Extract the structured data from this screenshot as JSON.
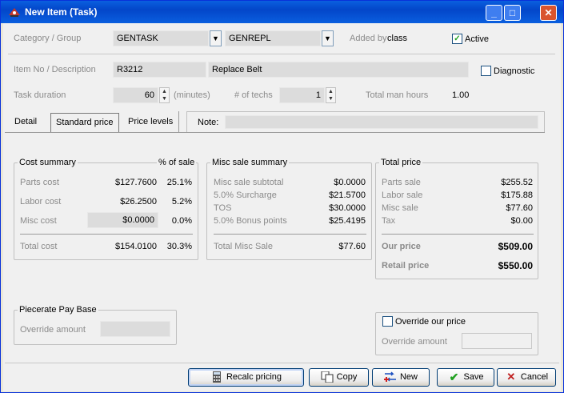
{
  "window": {
    "title": "New Item (Task)"
  },
  "header": {
    "category_group_label": "Category / Group",
    "category_value": "GENTASK",
    "group_value": "GENREPL",
    "added_by_label": "Added by",
    "added_by_value": "class",
    "active_label": "Active",
    "active_checked": true
  },
  "item": {
    "item_no_label": "Item No / Description",
    "item_no_value": "R3212",
    "description_value": "Replace Belt",
    "diagnostic_label": "Diagnostic",
    "diagnostic_checked": false,
    "task_duration_label": "Task duration",
    "task_duration_value": "60",
    "minutes_label": "(minutes)",
    "techs_label": "# of techs",
    "techs_value": "1",
    "total_man_hours_label": "Total man hours",
    "total_man_hours_value": "1.00"
  },
  "tabs": [
    {
      "label": "Detail"
    },
    {
      "label": "Standard price"
    },
    {
      "label": "Price levels"
    }
  ],
  "note_label": "Note:",
  "cost_summary": {
    "title": "Cost summary",
    "pct_header": "% of sale",
    "rows": [
      {
        "label": "Parts cost",
        "value": "$127.7600",
        "pct": "25.1%"
      },
      {
        "label": "Labor cost",
        "value": "$26.2500",
        "pct": "5.2%"
      },
      {
        "label": "Misc cost",
        "value": "$0.0000",
        "pct": "0.0%"
      }
    ],
    "total_label": "Total cost",
    "total_value": "$154.0100",
    "total_pct": "30.3%"
  },
  "misc_summary": {
    "title": "Misc sale summary",
    "rows": [
      {
        "label": "Misc sale subtotal",
        "value": "$0.0000"
      },
      {
        "label": "5.0% Surcharge",
        "value": "$21.5700"
      },
      {
        "label": "TOS",
        "value": "$30.0000"
      },
      {
        "label": "5.0% Bonus points",
        "value": "$25.4195"
      }
    ],
    "total_label": "Total Misc Sale",
    "total_value": "$77.60"
  },
  "total_price": {
    "title": "Total price",
    "rows": [
      {
        "label": "Parts sale",
        "value": "$255.52"
      },
      {
        "label": "Labor sale",
        "value": "$175.88"
      },
      {
        "label": "Misc sale",
        "value": "$77.60"
      },
      {
        "label": "Tax",
        "value": "$0.00"
      }
    ],
    "our_price_label": "Our price",
    "our_price_value": "$509.00",
    "retail_price_label": "Retail price",
    "retail_price_value": "$550.00"
  },
  "piecerate": {
    "title": "Piecerate Pay Base",
    "override_amount_label": "Override amount"
  },
  "override_price": {
    "checkbox_label": "Override our price",
    "override_amount_label": "Override amount"
  },
  "buttons": {
    "recalc": "Recalc pricing",
    "copy": "Copy",
    "new": "New",
    "save": "Save",
    "cancel": "Cancel"
  }
}
